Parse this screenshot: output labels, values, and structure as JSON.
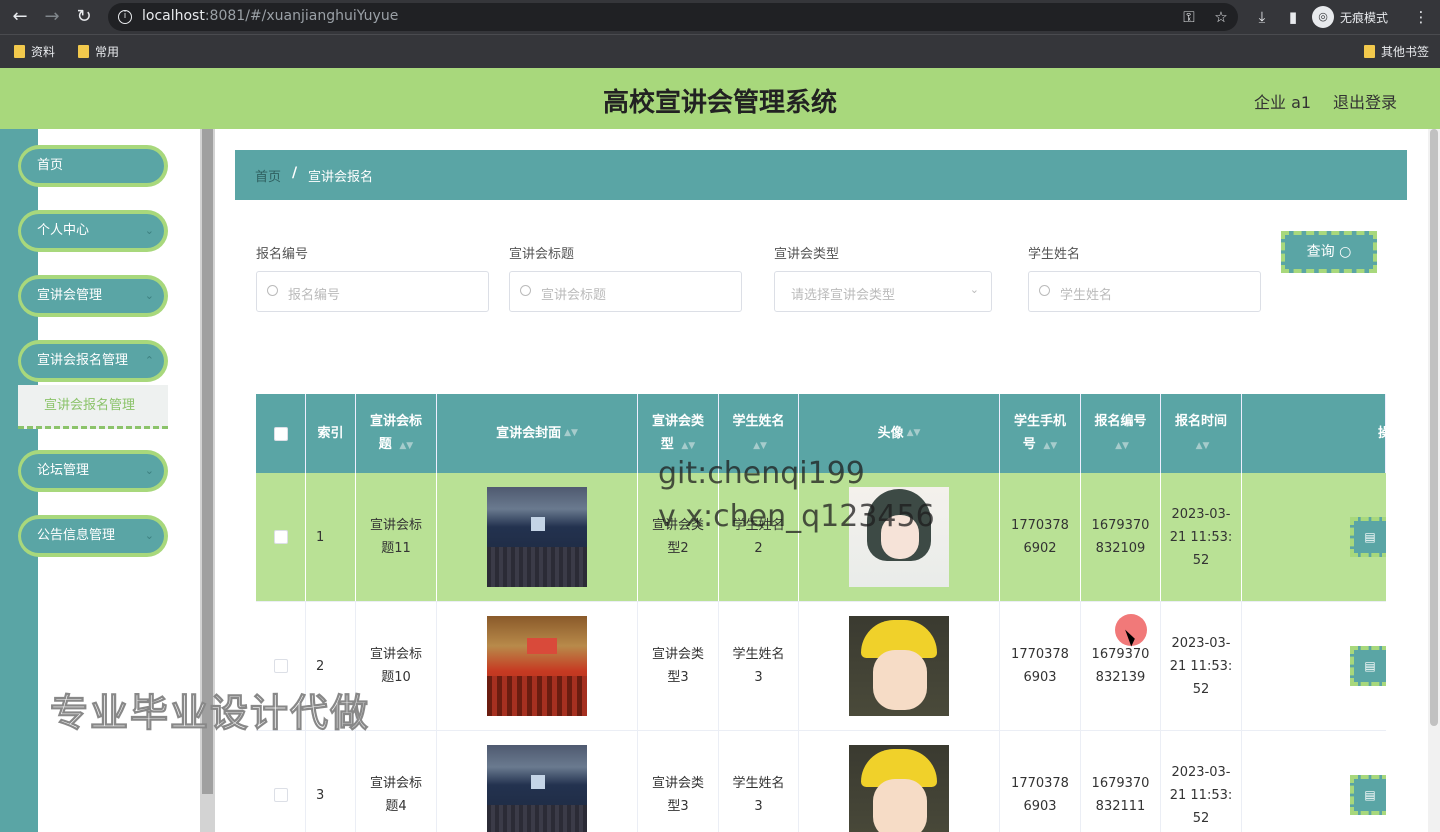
{
  "browser": {
    "url_host": "localhost",
    "url_rest": ":8081/#/xuanjianghuiYuyue",
    "incognito_label": "无痕模式",
    "bookmarks": [
      "资料",
      "常用"
    ],
    "other_bookmarks": "其他书签"
  },
  "header": {
    "title": "高校宣讲会管理系统",
    "user": "企业 a1",
    "logout": "退出登录"
  },
  "sidebar": {
    "items": [
      {
        "label": "首页"
      },
      {
        "label": "个人中心"
      },
      {
        "label": "宣讲会管理"
      },
      {
        "label": "宣讲会报名管理"
      },
      {
        "label": "论坛管理"
      },
      {
        "label": "公告信息管理"
      }
    ],
    "active_sub": "宣讲会报名管理"
  },
  "breadcrumb": {
    "home": "首页",
    "sep": "/",
    "current": "宣讲会报名"
  },
  "filters": {
    "labels": [
      "报名编号",
      "宣讲会标题",
      "宣讲会类型",
      "学生姓名"
    ],
    "placeholders": [
      "报名编号",
      "宣讲会标题",
      "请选择宣讲会类型",
      "学生姓名"
    ],
    "query_button": "查询"
  },
  "table": {
    "headers": [
      "索引",
      "宣讲会标题",
      "宣讲会封面",
      "宣讲会类型",
      "学生姓名",
      "头像",
      "学生手机号",
      "报名编号",
      "报名时间",
      "操"
    ],
    "rows": [
      {
        "index": "1",
        "title": "宣讲会标题11",
        "type": "宣讲会类型2",
        "student": "学生姓名2",
        "phone": "17703786902",
        "reg_no": "1679370832109",
        "time": "2023-03-21 11:53:52"
      },
      {
        "index": "2",
        "title": "宣讲会标题10",
        "type": "宣讲会类型3",
        "student": "学生姓名3",
        "phone": "17703786903",
        "reg_no": "1679370832139",
        "time": "2023-03-21 11:53:52"
      },
      {
        "index": "3",
        "title": "宣讲会标题4",
        "type": "宣讲会类型3",
        "student": "学生姓名3",
        "phone": "17703786903",
        "reg_no": "1679370832111",
        "time": "2023-03-21 11:53:52"
      }
    ]
  },
  "watermarks": {
    "line1": "git:chenqi199",
    "line2": "v x:chen_q123456",
    "promo": "专业毕业设计代做"
  },
  "colors": {
    "primary": "#5aa5a5",
    "accent": "#a8d87c",
    "highlight_row": "#b9e195"
  }
}
